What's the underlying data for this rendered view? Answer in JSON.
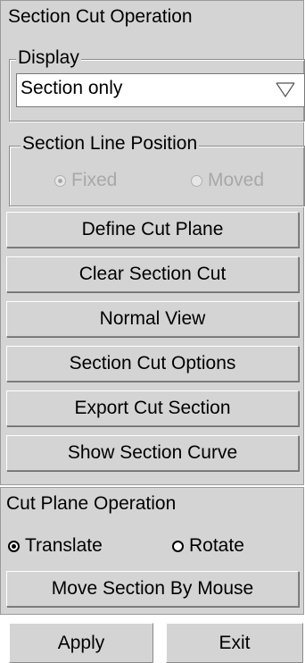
{
  "section_cut": {
    "title": "Section Cut Operation",
    "display": {
      "legend": "Display",
      "selected": "Section only",
      "arrow_icon": "dropdown-arrow-icon"
    },
    "line_position": {
      "legend": "Section Line Position",
      "options": [
        {
          "label": "Fixed",
          "selected": true,
          "enabled": false
        },
        {
          "label": "Moved",
          "selected": false,
          "enabled": false
        }
      ]
    },
    "buttons": [
      "Define Cut Plane",
      "Clear Section Cut",
      "Normal View",
      "Section Cut Options",
      "Export Cut Section",
      "Show Section Curve"
    ]
  },
  "cut_plane": {
    "title": "Cut Plane Operation",
    "options": [
      {
        "label": "Translate",
        "selected": true
      },
      {
        "label": "Rotate",
        "selected": false
      }
    ],
    "move_button": "Move Section By Mouse"
  },
  "footer": {
    "apply": "Apply",
    "exit": "Exit"
  },
  "colors": {
    "panel_bg": "#d4d4d4",
    "disabled_text": "#a8a8a8"
  }
}
